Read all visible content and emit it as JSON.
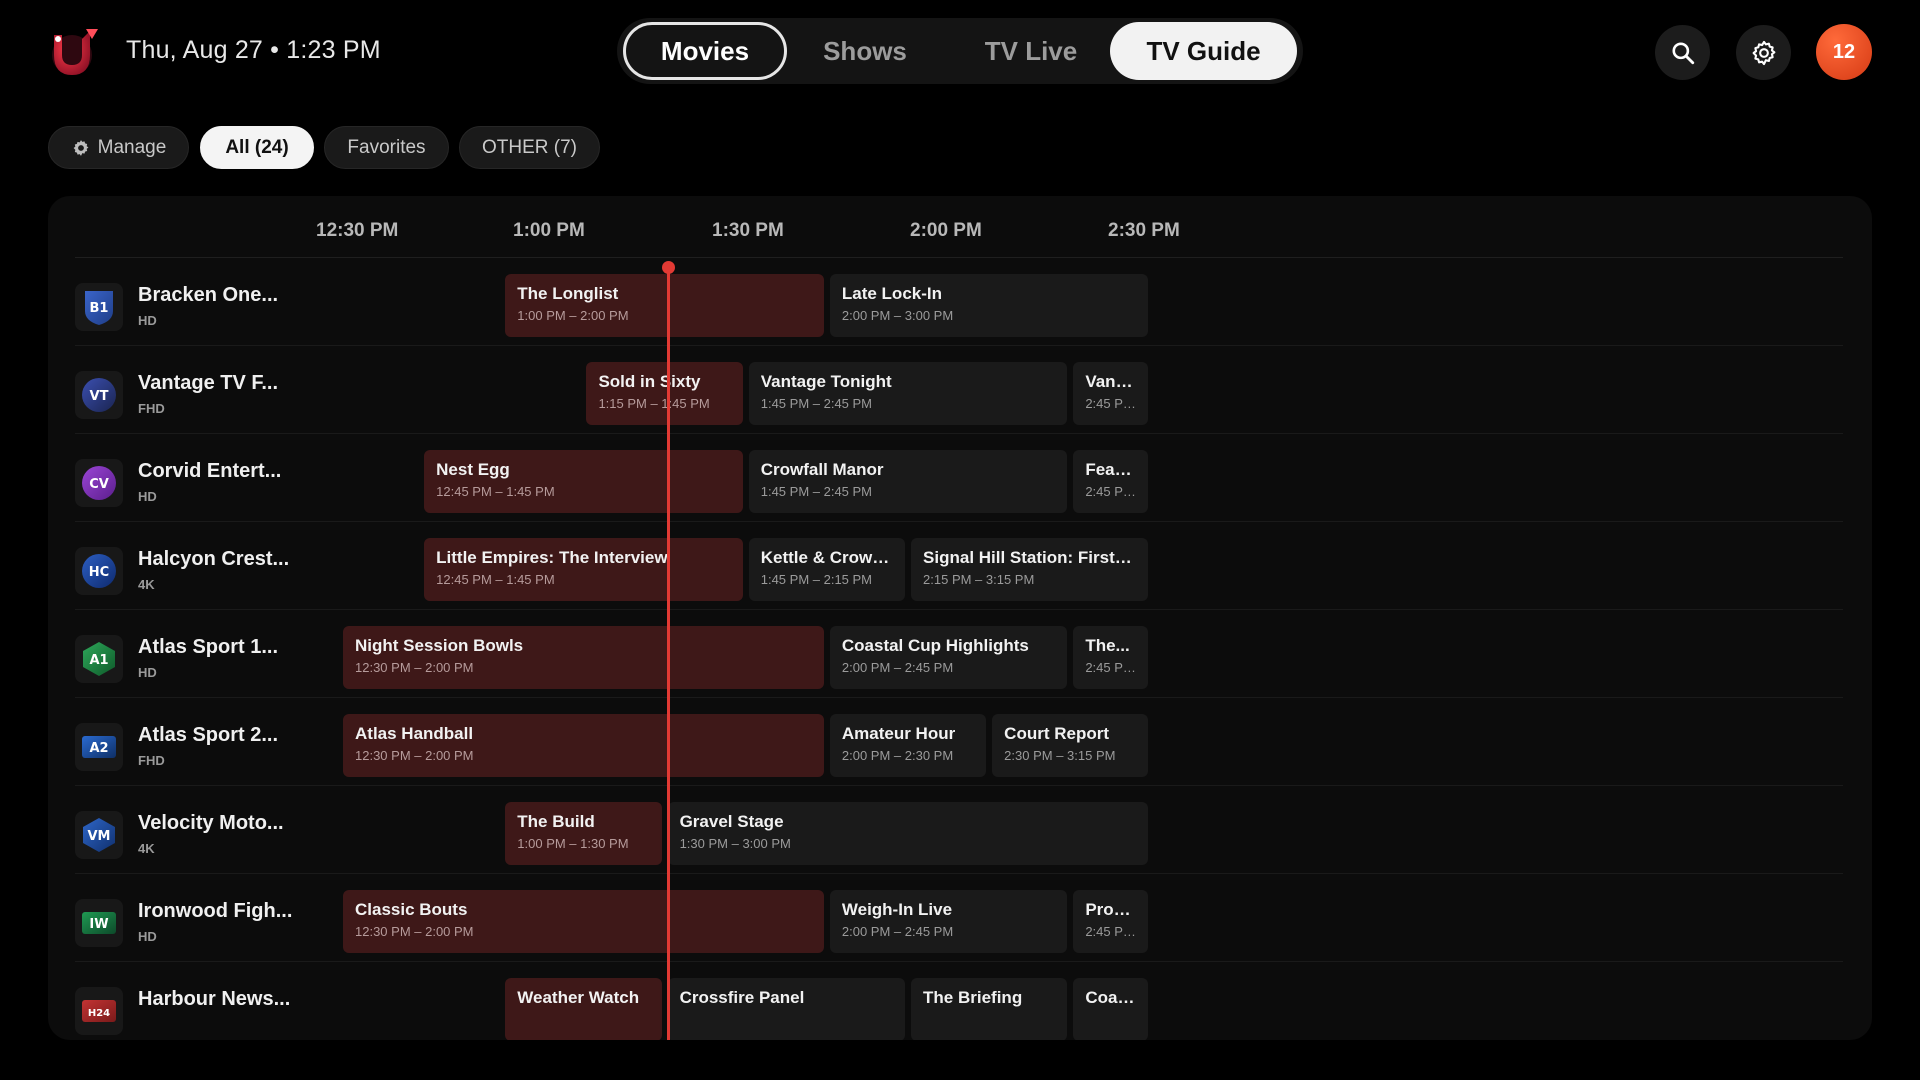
{
  "header": {
    "datetime": "Thu, Aug 27 • 1:23 PM",
    "logo_icon": "brand-logo",
    "tabs": [
      {
        "label": "Movies",
        "state": "focused"
      },
      {
        "label": "Shows",
        "state": "normal"
      },
      {
        "label": "TV Live",
        "state": "normal"
      },
      {
        "label": "TV Guide",
        "state": "selected"
      }
    ],
    "search_icon": "search-icon",
    "settings_icon": "gear-icon",
    "avatar_label": "12",
    "accent_color": "#e23a34"
  },
  "filters": [
    {
      "label": "Manage",
      "icon": "gear-icon"
    },
    {
      "label": "All (24)",
      "selected": true
    },
    {
      "label": "Favorites"
    },
    {
      "label": "OTHER (7)"
    }
  ],
  "guide": {
    "times": [
      "12:30 PM",
      "1:00 PM",
      "1:30 PM",
      "2:00 PM",
      "2:30 PM"
    ],
    "now": "1:23 PM",
    "channels": [
      {
        "logo": "B1",
        "name": "Bracken One...",
        "quality": "HD",
        "programs": [
          {
            "title": "The Longlist",
            "time": "1:00 PM – 2:00 PM",
            "live": true
          },
          {
            "title": "Late Lock-In",
            "time": "2:00 PM – 3:00 PM"
          }
        ]
      },
      {
        "logo": "VT",
        "name": "Vantage TV F...",
        "quality": "FHD",
        "programs": [
          {
            "title": "Sold in Sixty",
            "time": "1:15 PM – 1:45 PM",
            "live": true
          },
          {
            "title": "Vantage Tonight",
            "time": "1:45 PM – 2:45 PM"
          },
          {
            "title": "Vanta...",
            "time": "2:45 PM..."
          }
        ]
      },
      {
        "logo": "CV",
        "name": "Corvid Entert...",
        "quality": "HD",
        "programs": [
          {
            "title": "Nest Egg",
            "time": "12:45 PM – 1:45 PM",
            "live": true
          },
          {
            "title": "Crowfall Manor",
            "time": "1:45 PM – 2:45 PM"
          },
          {
            "title": "Feath...",
            "time": "2:45 PM..."
          }
        ]
      },
      {
        "logo": "HC",
        "name": "Halcyon Crest...",
        "quality": "4K",
        "programs": [
          {
            "title": "Little Empires: The Interview",
            "time": "12:45 PM – 1:45 PM",
            "live": true
          },
          {
            "title": "Kettle & Crow: Te...",
            "time": "1:45 PM – 2:15 PM"
          },
          {
            "title": "Signal Hill Station: First Light",
            "time": "2:15 PM – 3:15 PM"
          }
        ]
      },
      {
        "logo": "A1",
        "name": "Atlas Sport 1...",
        "quality": "HD",
        "programs": [
          {
            "title": "Night Session Bowls",
            "time": "12:30 PM – 2:00 PM",
            "live": true
          },
          {
            "title": "Coastal Cup Highlights",
            "time": "2:00 PM – 2:45 PM"
          },
          {
            "title": "The...",
            "time": "2:45 PM..."
          }
        ]
      },
      {
        "logo": "A2",
        "name": "Atlas Sport 2...",
        "quality": "FHD",
        "programs": [
          {
            "title": "Atlas Handball",
            "time": "12:30 PM – 2:00 PM",
            "live": true
          },
          {
            "title": "Amateur Hour",
            "time": "2:00 PM – 2:30 PM"
          },
          {
            "title": "Court Report",
            "time": "2:30 PM – 3:15 PM"
          }
        ]
      },
      {
        "logo": "VM",
        "name": "Velocity Moto...",
        "quality": "4K",
        "programs": [
          {
            "title": "The Build",
            "time": "1:00 PM – 1:30 PM",
            "live": true
          },
          {
            "title": "Gravel Stage",
            "time": "1:30 PM – 3:00 PM"
          }
        ]
      },
      {
        "logo": "IW",
        "name": "Ironwood Figh...",
        "quality": "HD",
        "programs": [
          {
            "title": "Classic Bouts",
            "time": "12:30 PM – 2:00 PM",
            "live": true
          },
          {
            "title": "Weigh-In Live",
            "time": "2:00 PM – 2:45 PM"
          },
          {
            "title": "Prosp...",
            "time": "2:45 PM..."
          }
        ]
      },
      {
        "logo": "H24",
        "name": "Harbour News...",
        "quality": "",
        "programs": [
          {
            "title": "Weather Watch",
            "time": "",
            "live": true
          },
          {
            "title": "Crossfire Panel",
            "time": ""
          },
          {
            "title": "The Briefing",
            "time": ""
          },
          {
            "title": "Coast...",
            "time": ""
          }
        ]
      }
    ]
  }
}
